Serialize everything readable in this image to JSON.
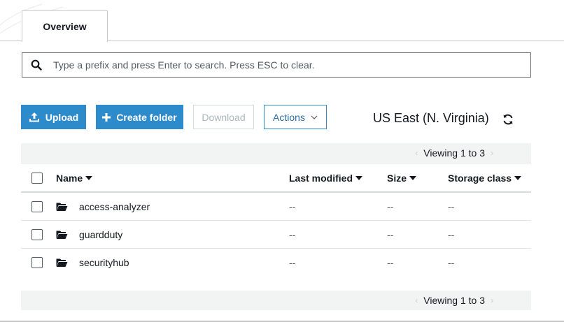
{
  "tabs": [
    {
      "label": "Overview",
      "active": true
    }
  ],
  "search": {
    "placeholder": "Type a prefix and press Enter to search. Press ESC to clear.",
    "value": ""
  },
  "toolbar": {
    "upload_label": "Upload",
    "create_folder_label": "Create folder",
    "download_label": "Download",
    "actions_label": "Actions",
    "region": "US East (N. Virginia)"
  },
  "pagination": {
    "text": "Viewing 1 to 3"
  },
  "table": {
    "columns": [
      "Name",
      "Last modified",
      "Size",
      "Storage class"
    ],
    "rows": [
      {
        "name": "access-analyzer",
        "last_modified": "--",
        "size": "--",
        "storage_class": "--"
      },
      {
        "name": "guardduty",
        "last_modified": "--",
        "size": "--",
        "storage_class": "--"
      },
      {
        "name": "securityhub",
        "last_modified": "--",
        "size": "--",
        "storage_class": "--"
      }
    ]
  },
  "colors": {
    "primary": "#2d8acb",
    "border": "#c8c8c8",
    "bar": "#f2f3f3"
  },
  "icons": [
    "search-icon",
    "upload-icon",
    "plus-icon",
    "chevron-down-icon",
    "refresh-icon",
    "folder-icon",
    "sort-caret-icon"
  ]
}
